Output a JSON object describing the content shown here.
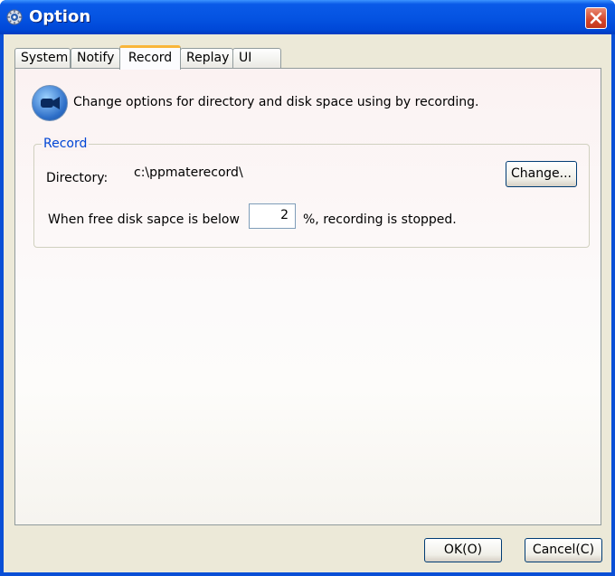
{
  "window": {
    "title": "Option",
    "title_icon": "app-gear-icon",
    "close_icon": "close-x-icon"
  },
  "tabs": [
    {
      "label": "System",
      "active": false
    },
    {
      "label": "Notify",
      "active": false
    },
    {
      "label": "Record",
      "active": true
    },
    {
      "label": "Replay",
      "active": false
    },
    {
      "label": "UI",
      "active": false
    }
  ],
  "record_page": {
    "info_icon": "camera-icon",
    "description": "Change options for directory and disk space using by recording.",
    "group_title": "Record",
    "directory_label": "Directory:",
    "directory_value": "c:\\ppmaterecord\\",
    "change_button": "Change...",
    "disk_label_prefix": "When free disk sapce is below",
    "disk_value": "2",
    "disk_label_suffix": "%, recording is stopped."
  },
  "footer": {
    "ok_label": "OK(O)",
    "cancel_label": "Cancel(C)"
  },
  "colors": {
    "title_bar": "#0554e2",
    "close_button": "#d3452a",
    "active_tab_accent": "#f9b63a",
    "group_title": "#0046d5"
  }
}
